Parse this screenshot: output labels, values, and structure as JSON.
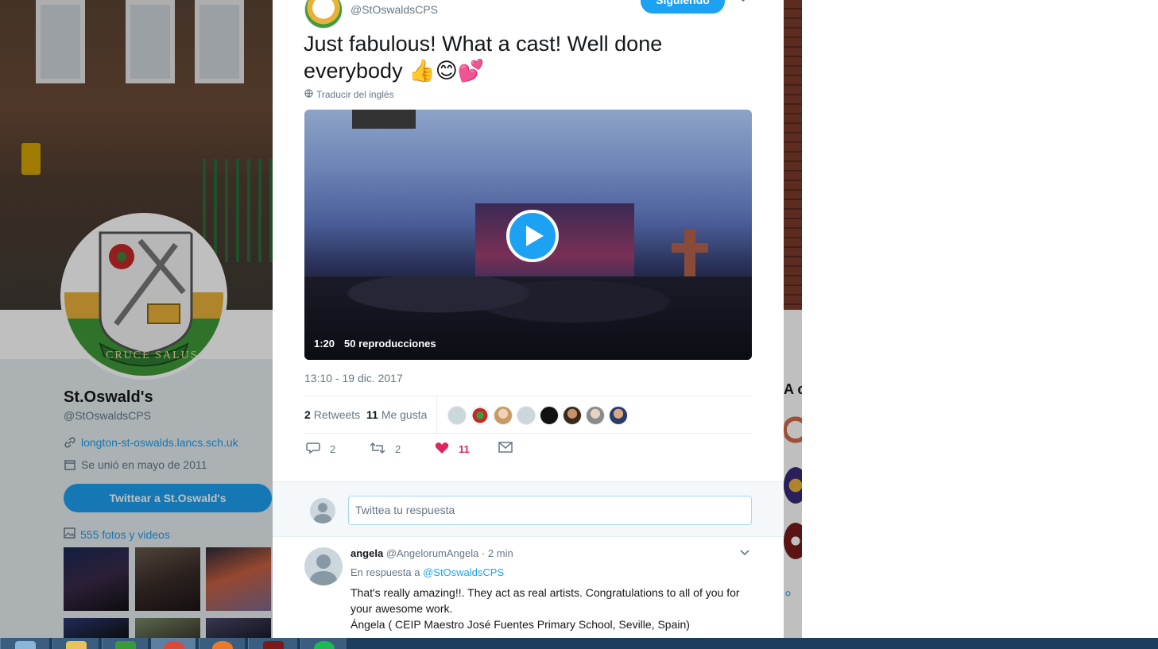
{
  "profile": {
    "name": "St.Oswald's",
    "handle": "@StOswaldsCPS",
    "link": "longton-st-oswalds.lancs.sch.uk",
    "joined": "Se unió en mayo de 2011",
    "tweet_to": "Twittear a St.Oswald's",
    "photos": "555 fotos y videos",
    "crest_motto": "CRUCE SALUS",
    "right_heading": "A c"
  },
  "tweet": {
    "author_handle": "@StOswaldsCPS",
    "follow_label": "Siguiendo",
    "text": "Just fabulous! What a cast! Well done everybody 👍😊💕",
    "translate": "Traducir del inglés",
    "video": {
      "duration": "1:20",
      "views": "50 reproducciones"
    },
    "timestamp": "13:10 - 19 dic. 2017",
    "retweets_count": "2",
    "retweets_label": "Retweets",
    "likes_count": "11",
    "likes_label": "Me gusta",
    "actions": {
      "replies": "2",
      "retweets": "2",
      "likes": "11"
    }
  },
  "reply_box": {
    "placeholder": "Twittea tu respuesta"
  },
  "reply": {
    "name": "angela",
    "handle": "@AngelorumAngela",
    "time": "· 2 min",
    "in_reply_prefix": "En respuesta a",
    "in_reply_handle": "@StOswaldsCPS",
    "text_line1": "That's really amazing!!. They act as real artists. Congratulations to all of you for your awesome work.",
    "text_line2": "Ángela ( CEIP Maestro José Fuentes Primary School, Seville, Spain)"
  },
  "colors": {
    "accent": "#1da1f2",
    "like": "#e0245e",
    "muted_text": "#657786"
  }
}
